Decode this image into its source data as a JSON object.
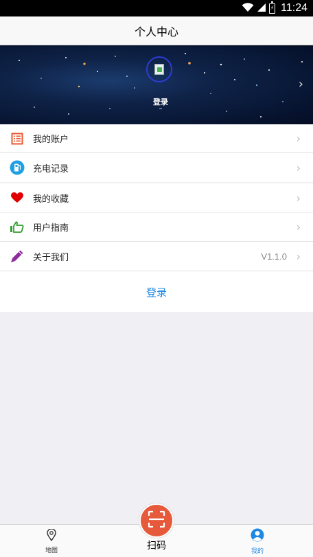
{
  "status_bar": {
    "time": "11:24"
  },
  "header": {
    "title": "个人中心"
  },
  "profile": {
    "login_label": "登录",
    "sub_label": "–"
  },
  "groups": [
    {
      "items": [
        {
          "label": "我的账户",
          "icon": "account-list-icon",
          "color": "#e8572f"
        },
        {
          "label": "充电记录",
          "icon": "charge-record-icon",
          "color": "#1ea0e3"
        }
      ]
    },
    {
      "items": [
        {
          "label": "我的收藏",
          "icon": "heart-icon",
          "color": "#e00000"
        }
      ]
    },
    {
      "items": [
        {
          "label": "用户指南",
          "icon": "thumbs-up-icon",
          "color": "#2e9e2e"
        },
        {
          "label": "关于我们",
          "icon": "pencil-icon",
          "color": "#8e2a9c",
          "value": "V1.1.0"
        }
      ]
    }
  ],
  "login_button": {
    "label": "登录",
    "color": "#1e88e5"
  },
  "tab_bar": {
    "map_label": "地图",
    "scan_label": "扫码",
    "me_label": "我的",
    "active_color": "#1e88e5",
    "scan_color": "#e65a3b"
  }
}
